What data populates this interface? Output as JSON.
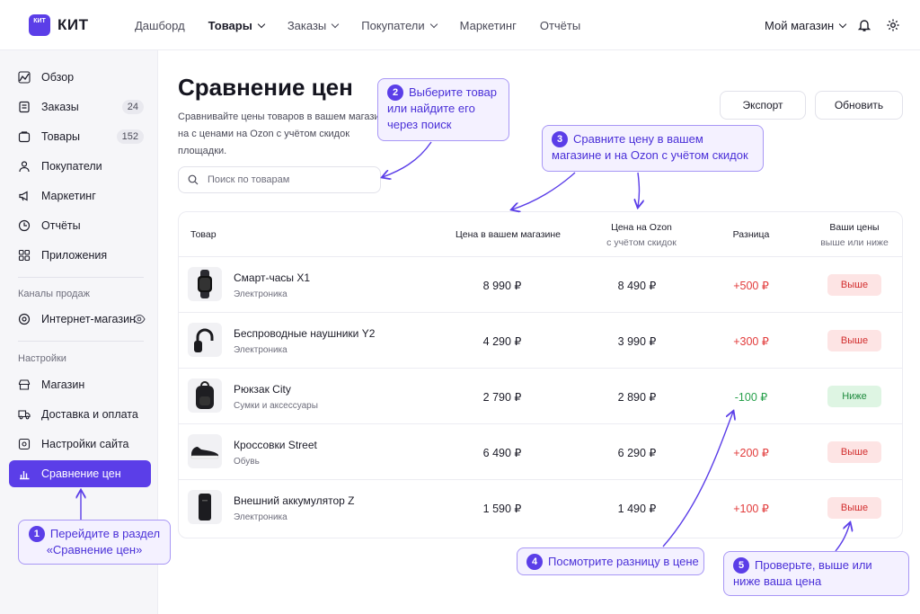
{
  "app": {
    "logo_small": "КИТ",
    "name": "КИТ"
  },
  "nav": [
    {
      "label": "Дашборд",
      "dropdown": false,
      "active": false
    },
    {
      "label": "Товары",
      "dropdown": true,
      "active": true
    },
    {
      "label": "Заказы",
      "dropdown": true,
      "active": false
    },
    {
      "label": "Покупатели",
      "dropdown": true,
      "active": false
    },
    {
      "label": "Маркетинг",
      "dropdown": false,
      "active": false
    },
    {
      "label": "Отчёты",
      "dropdown": false,
      "active": false
    }
  ],
  "store_switch": "Мой магазин",
  "sidebar": {
    "items": [
      {
        "label": "Обзор",
        "icon": "overview-icon"
      },
      {
        "label": "Заказы",
        "icon": "orders-icon",
        "badge": "24"
      },
      {
        "label": "Товары",
        "icon": "products-icon",
        "badge": "152"
      },
      {
        "label": "Покупатели",
        "icon": "customers-icon"
      },
      {
        "label": "Маркетинг",
        "icon": "megaphone-icon"
      },
      {
        "label": "Отчёты",
        "icon": "reports-icon"
      },
      {
        "label": "Приложения",
        "icon": "apps-icon"
      }
    ],
    "channels_title": "Каналы продаж",
    "channels": [
      {
        "label": "Интернет-магазин",
        "icon": "store-channel-icon"
      }
    ],
    "settings_title": "Настройки",
    "settings": [
      {
        "label": "Магазин",
        "icon": "shop-icon"
      },
      {
        "label": "Доставка и оплата",
        "icon": "truck-icon"
      },
      {
        "label": "Настройки сайта",
        "icon": "site-settings-icon"
      },
      {
        "label": "Сравнение цен",
        "icon": "bar-chart-icon",
        "active": true
      }
    ]
  },
  "page": {
    "title": "Сравнение цен",
    "subtitle": "Сравнивайте цены товаров в вашем магазине на с ценами на Ozon с учётом скидок площадки.",
    "export_label": "Экспорт",
    "refresh_label": "Обновить",
    "search_placeholder": "Поиск по товарам"
  },
  "table": {
    "headers": {
      "product": "Товар",
      "store_price": "Цена в вашем магазине",
      "ozon_price": "Цена на Ozon",
      "ozon_price_sub": "с учётом скидок",
      "difference": "Разница",
      "your_prices": "Ваши цены",
      "your_prices_sub": "выше или ниже"
    },
    "rows": [
      {
        "name": "Смарт-часы X1",
        "category": "Электроника",
        "store_price": "8 990 ₽",
        "ozon_price": "8 490 ₽",
        "diff": "+500 ₽",
        "status": "Выше",
        "direction": "up",
        "icon": "smartwatch-icon"
      },
      {
        "name": "Беспроводные наушники Y2",
        "category": "Электроника",
        "store_price": "4 290 ₽",
        "ozon_price": "3 990 ₽",
        "diff": "+300 ₽",
        "status": "Выше",
        "direction": "up",
        "icon": "headphones-icon"
      },
      {
        "name": "Рюкзак City",
        "category": "Сумки и аксессуары",
        "store_price": "2 790 ₽",
        "ozon_price": "2 890 ₽",
        "diff": "-100 ₽",
        "status": "Ниже",
        "direction": "down",
        "icon": "backpack-icon"
      },
      {
        "name": "Кроссовки Street",
        "category": "Обувь",
        "store_price": "6 490 ₽",
        "ozon_price": "6 290 ₽",
        "diff": "+200 ₽",
        "status": "Выше",
        "direction": "up",
        "icon": "sneaker-icon"
      },
      {
        "name": "Внешний аккумулятор Z",
        "category": "Электроника",
        "store_price": "1 590 ₽",
        "ozon_price": "1 490 ₽",
        "diff": "+100 ₽",
        "status": "Выше",
        "direction": "up",
        "icon": "powerbank-icon"
      }
    ]
  },
  "callouts": [
    {
      "num": "1",
      "text": "Перейдите в раздел «Сравнение цен»"
    },
    {
      "num": "2",
      "text": "Выберите товар или найдите его через поиск"
    },
    {
      "num": "3",
      "text": "Сравните цену в вашем магазине и на Ozon с учётом скидок"
    },
    {
      "num": "4",
      "text": "Посмотрите разницу в цене"
    },
    {
      "num": "5",
      "text": "Проверьте, выше или ниже ваша цена"
    }
  ],
  "colors": {
    "accent": "#5b3ee8",
    "up": "#e23b3b",
    "down": "#27a04b"
  }
}
